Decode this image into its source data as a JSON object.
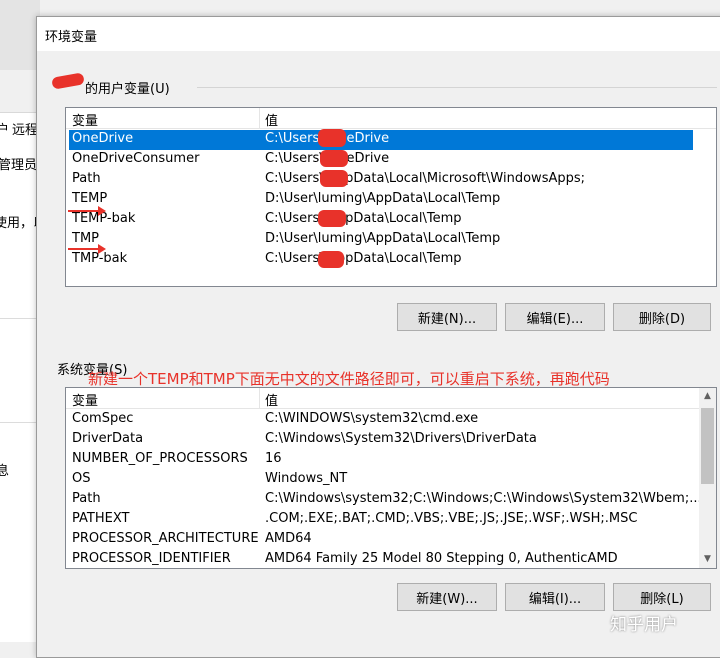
{
  "background_window": {
    "tab_fragments": [
      "户",
      "远程"
    ],
    "text_fragments": [
      "管理员",
      "使用，以",
      "息"
    ]
  },
  "dialog": {
    "title": "环境变量"
  },
  "user_vars": {
    "group_label": "的用户变量(U)",
    "columns": [
      "变量",
      "值"
    ],
    "rows": [
      {
        "name": "OneDrive",
        "value": "C:\\Users\\\\OneDrive",
        "selected": true
      },
      {
        "name": "OneDriveConsumer",
        "value": "C:\\Users\\\\OneDrive",
        "selected": false
      },
      {
        "name": "Path",
        "value": "C:\\Users\\\\AppData\\Local\\Microsoft\\WindowsApps;",
        "selected": false
      },
      {
        "name": "TEMP",
        "value": "D:\\User\\luming\\AppData\\Local\\Temp",
        "selected": false
      },
      {
        "name": "TEMP-bak",
        "value": "C:\\Users\\\\AppData\\Local\\Temp",
        "selected": false
      },
      {
        "name": "TMP",
        "value": "D:\\User\\luming\\AppData\\Local\\Temp",
        "selected": false
      },
      {
        "name": "TMP-bak",
        "value": "C:\\Users\\\\AppData\\Local\\Temp",
        "selected": false
      }
    ],
    "buttons": {
      "new": "新建(N)...",
      "edit": "编辑(E)...",
      "delete": "删除(D)"
    }
  },
  "system_vars": {
    "group_label": "系统变量(S)",
    "columns": [
      "变量",
      "值"
    ],
    "rows": [
      {
        "name": "ComSpec",
        "value": "C:\\WINDOWS\\system32\\cmd.exe"
      },
      {
        "name": "DriverData",
        "value": "C:\\Windows\\System32\\Drivers\\DriverData"
      },
      {
        "name": "NUMBER_OF_PROCESSORS",
        "value": "16"
      },
      {
        "name": "OS",
        "value": "Windows_NT"
      },
      {
        "name": "Path",
        "value": "C:\\Windows\\system32;C:\\Windows;C:\\Windows\\System32\\Wbem;..."
      },
      {
        "name": "PATHEXT",
        "value": ".COM;.EXE;.BAT;.CMD;.VBS;.VBE;.JS;.JSE;.WSF;.WSH;.MSC"
      },
      {
        "name": "PROCESSOR_ARCHITECTURE",
        "value": "AMD64"
      },
      {
        "name": "PROCESSOR_IDENTIFIER",
        "value": "AMD64 Family 25 Model 80 Stepping 0, AuthenticAMD"
      }
    ],
    "buttons": {
      "new": "新建(W)...",
      "edit": "编辑(I)...",
      "delete": "删除(L)"
    }
  },
  "annotation": "新建一个TEMP和TMP下面无中文的文件路径即可，可以重启下系统，再跑代码",
  "watermark": "知乎用户",
  "colors": {
    "selection": "#0078d7",
    "annotation": "#e8322a"
  }
}
